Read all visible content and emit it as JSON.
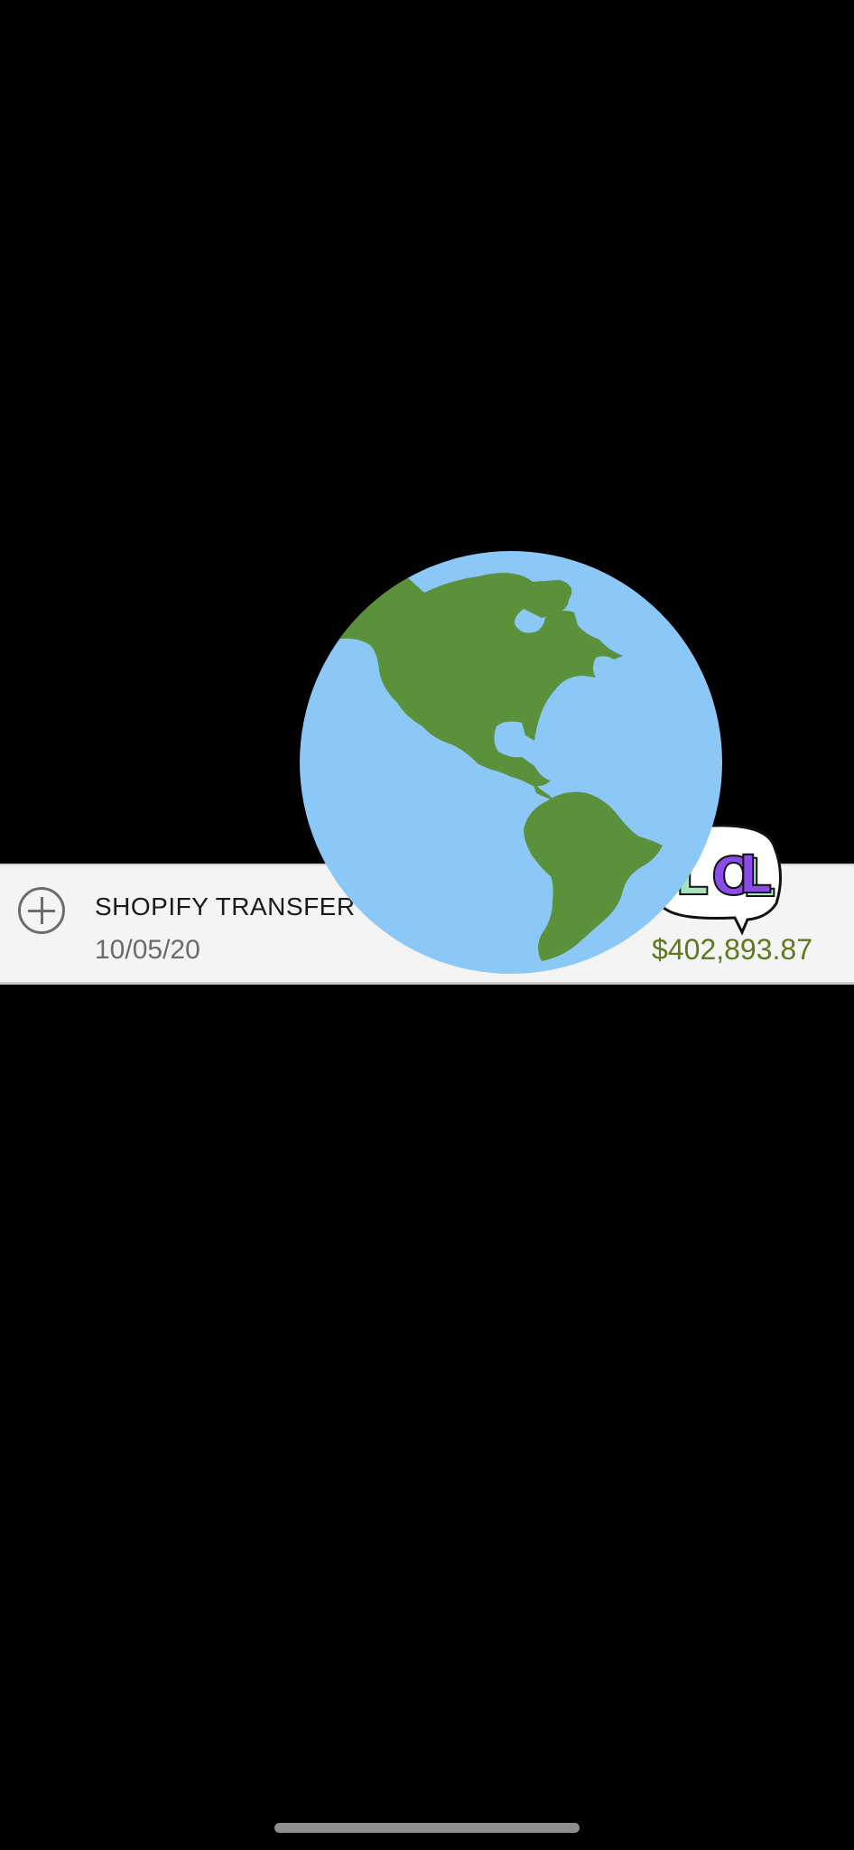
{
  "transaction": {
    "merchant": "SHOPIFY TRANSFER S",
    "date": "10/05/20",
    "sign": "+",
    "amount": "$402,893.87",
    "amount_color": "#5c7a1c"
  },
  "stickers": {
    "globe": "globe-americas-icon",
    "lol_text": "LOL"
  },
  "colors": {
    "ocean": "#8bc8f7",
    "land": "#5a913a",
    "background": "#000000",
    "card": "#f4f4f4"
  }
}
